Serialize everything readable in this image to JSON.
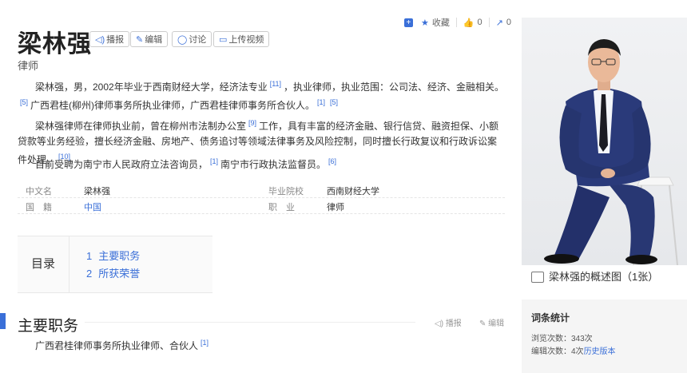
{
  "title": "梁林强",
  "subtitle": "律师",
  "toolbar": {
    "broadcast": "播报",
    "edit": "编辑",
    "discuss": "讨论",
    "upload_video": "上传视频"
  },
  "actions": {
    "collect": "收藏",
    "like_count": "0",
    "share_count": "0"
  },
  "paragraphs": {
    "p1_a": "梁林强，男，2002年毕业于西南财经大学，经济法专业",
    "p1_r1": "[11]",
    "p1_b": "，执业律师，执业范围：公司法、经济、金融相关。",
    "p1_r2": "[5]",
    "p1_c": "广西君桂(柳州)律师事务所执业律师，广西君桂律师事务所合伙人。",
    "p1_r3": "[1]",
    "p1_r4": "[5]",
    "p2_a": "梁林强律师在律师执业前，曾在柳州市法制办公室",
    "p2_r1": "[9]",
    "p2_b": "工作，具有丰富的经济金融、银行信贷、融资担保、小额贷款等业务经验，擅长经济金融、房地产、债务追讨等领域法律事务及风险控制，同时擅长行政复议和行政诉讼案件处理。",
    "p2_r2": "[10]",
    "p3_a": "目前受聘为南宁市人民政府立法咨询员，",
    "p3_r1": "[1]",
    "p3_b": "南宁市行政执法监督员。",
    "p3_r2": "[6]"
  },
  "basic_info": {
    "chinese_name_label": "中文名",
    "chinese_name": "梁林强",
    "school_label": "毕业院校",
    "school": "西南财经大学",
    "nationality_label": "国　籍",
    "nationality": "中国",
    "profession_label": "职　业",
    "profession": "律师"
  },
  "toc": {
    "label": "目录",
    "items": [
      {
        "num": "1",
        "text": "主要职务"
      },
      {
        "num": "2",
        "text": "所获荣誉"
      }
    ]
  },
  "section": {
    "title": "主要职务",
    "broadcast": "播报",
    "edit": "编辑",
    "body": "广西君桂律师事务所执业律师、合伙人",
    "ref": "[1]"
  },
  "photo_caption": "梁林强的概述图（1张）",
  "stats": {
    "heading": "词条统计",
    "views": "浏览次数：343次",
    "edits_prefix": "编辑次数：4次",
    "history_link": "历史版本"
  },
  "colors": {
    "accent": "#3a6fd8"
  }
}
